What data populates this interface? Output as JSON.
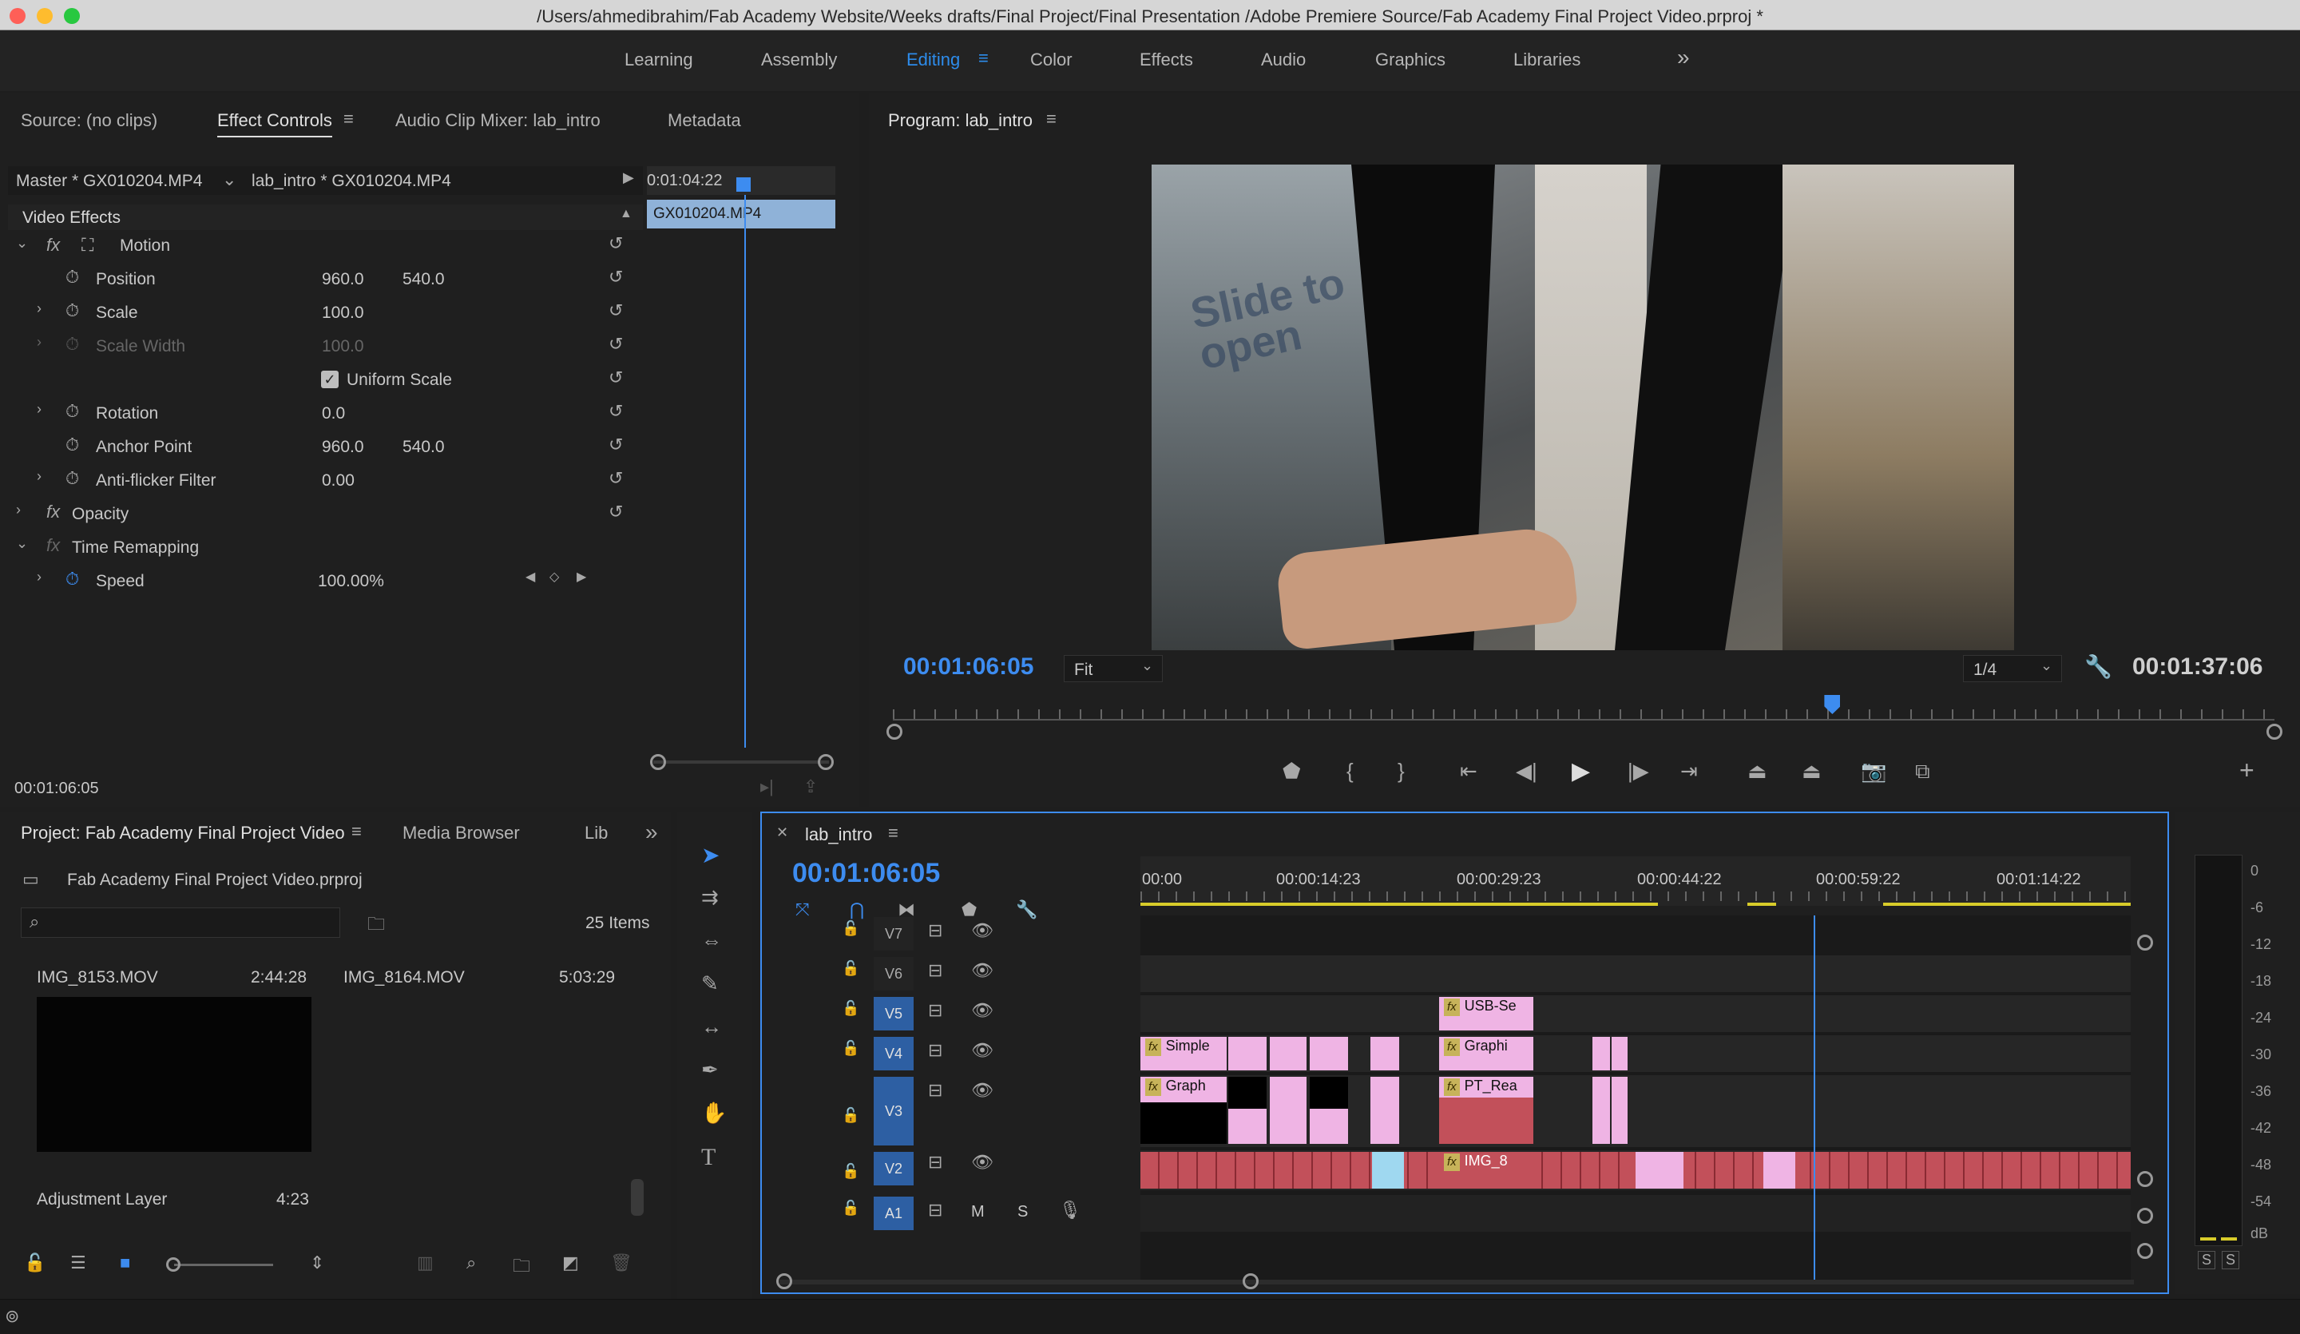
{
  "window": {
    "title": "/Users/ahmedibrahim/Fab Academy Website/Weeks drafts/Final Project/Final Presentation /Adobe Premiere Source/Fab Academy Final Project Video.prproj *"
  },
  "workspaces": {
    "items": [
      "Learning",
      "Assembly",
      "Editing",
      "Color",
      "Effects",
      "Audio",
      "Graphics",
      "Libraries"
    ],
    "active": "Editing",
    "more_glyph": "»"
  },
  "effect_panel": {
    "tabs": [
      "Source: (no clips)",
      "Effect Controls",
      "Audio Clip Mixer: lab_intro",
      "Metadata"
    ],
    "master_label": "Master * GX010204.MP4",
    "clip_label": "lab_intro * GX010204.MP4",
    "mini_timecode": "0:01:04:22",
    "mini_clip": "GX010204.MP4",
    "section": "Video Effects",
    "rows": [
      {
        "name": "Motion",
        "v1": "",
        "v2": ""
      },
      {
        "name": "Position",
        "v1": "960.0",
        "v2": "540.0"
      },
      {
        "name": "Scale",
        "v1": "100.0",
        "v2": ""
      },
      {
        "name": "Scale Width",
        "v1": "100.0",
        "v2": ""
      },
      {
        "name": "Uniform Scale",
        "v1": "",
        "v2": ""
      },
      {
        "name": "Rotation",
        "v1": "0.0",
        "v2": ""
      },
      {
        "name": "Anchor Point",
        "v1": "960.0",
        "v2": "540.0"
      },
      {
        "name": "Anti-flicker Filter",
        "v1": "0.00",
        "v2": ""
      },
      {
        "name": "Opacity",
        "v1": "",
        "v2": ""
      },
      {
        "name": "Time Remapping",
        "v1": "",
        "v2": ""
      },
      {
        "name": "Speed",
        "v1": "100.00%",
        "v2": ""
      }
    ],
    "footer_timecode": "00:01:06:05"
  },
  "program": {
    "tab": "Program: lab_intro",
    "timecode": "00:01:06:05",
    "fit": "Fit",
    "resolution": "1/4",
    "duration": "00:01:37:06",
    "playhead_fraction": 0.68,
    "video_text": "Slide to open"
  },
  "project": {
    "tabs": [
      "Project: Fab Academy Final Project Video",
      "Media Browser",
      "Lib"
    ],
    "file": "Fab Academy Final Project Video.prproj",
    "items_count": "25 Items",
    "thumbs": [
      {
        "name": "IMG_8153.MOV",
        "duration": "2:44:28"
      },
      {
        "name": "IMG_8164.MOV",
        "duration": "5:03:29"
      }
    ],
    "adjustment": {
      "name": "Adjustment Layer",
      "duration": "4:23"
    }
  },
  "timeline": {
    "tab": "lab_intro",
    "timecode": "00:01:06:05",
    "ruler": [
      "00:00",
      "00:00:14:23",
      "00:00:29:23",
      "00:00:44:22",
      "00:00:59:22",
      "00:01:14:22"
    ],
    "tracks": [
      "V7",
      "V6",
      "V5",
      "V4",
      "V3",
      "V2",
      "A1"
    ],
    "a1_buttons": [
      "M",
      "S"
    ],
    "clip_labels": {
      "usb": "USB-Se",
      "graphic": "Graphi",
      "simple": "Simple",
      "graph": "Graph",
      "pt": "PT_Rea",
      "img": "IMG_8"
    }
  },
  "meter": {
    "ticks": [
      "0",
      "-6",
      "-12",
      "-18",
      "-24",
      "-30",
      "-36",
      "-42",
      "-48",
      "-54",
      "dB"
    ],
    "solo": [
      "S",
      "S"
    ]
  },
  "colors": {
    "accent": "#2d8ceb",
    "panel": "#1f1f1f",
    "clip_pink": "#efb4e4",
    "clip_red": "#c2505a",
    "clip_cyan": "#9fd8f0",
    "yellow_bar": "#d8cc2a"
  }
}
